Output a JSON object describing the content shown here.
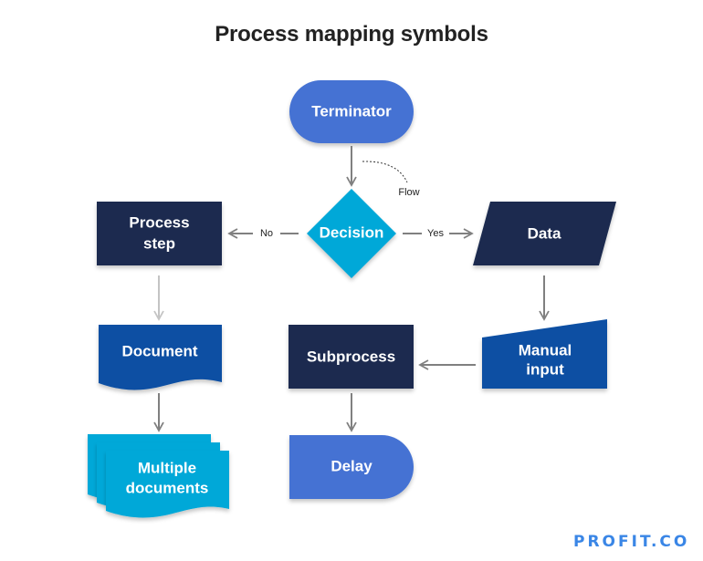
{
  "title": "Process mapping symbols",
  "colors": {
    "navy": "#1a2b4f",
    "royal_blue": "#4472d3",
    "cyan": "#04a8d8",
    "dark_blue": "#0a4fa3",
    "arrow_gray": "#808080",
    "arrow_light": "#c4c4c4",
    "logo_blue": "#3a86e6"
  },
  "nodes": {
    "terminator": "Terminator",
    "decision": "Decision",
    "process_step": [
      "Process",
      "step"
    ],
    "data": "Data",
    "document": "Document",
    "subprocess": "Subprocess",
    "manual_input": [
      "Manual",
      "input"
    ],
    "multiple_documents": [
      "Multiple",
      "documents"
    ],
    "delay": "Delay"
  },
  "edge_labels": {
    "flow": "Flow",
    "no": "No",
    "yes": "Yes"
  },
  "logo": "PROFIT.CO"
}
